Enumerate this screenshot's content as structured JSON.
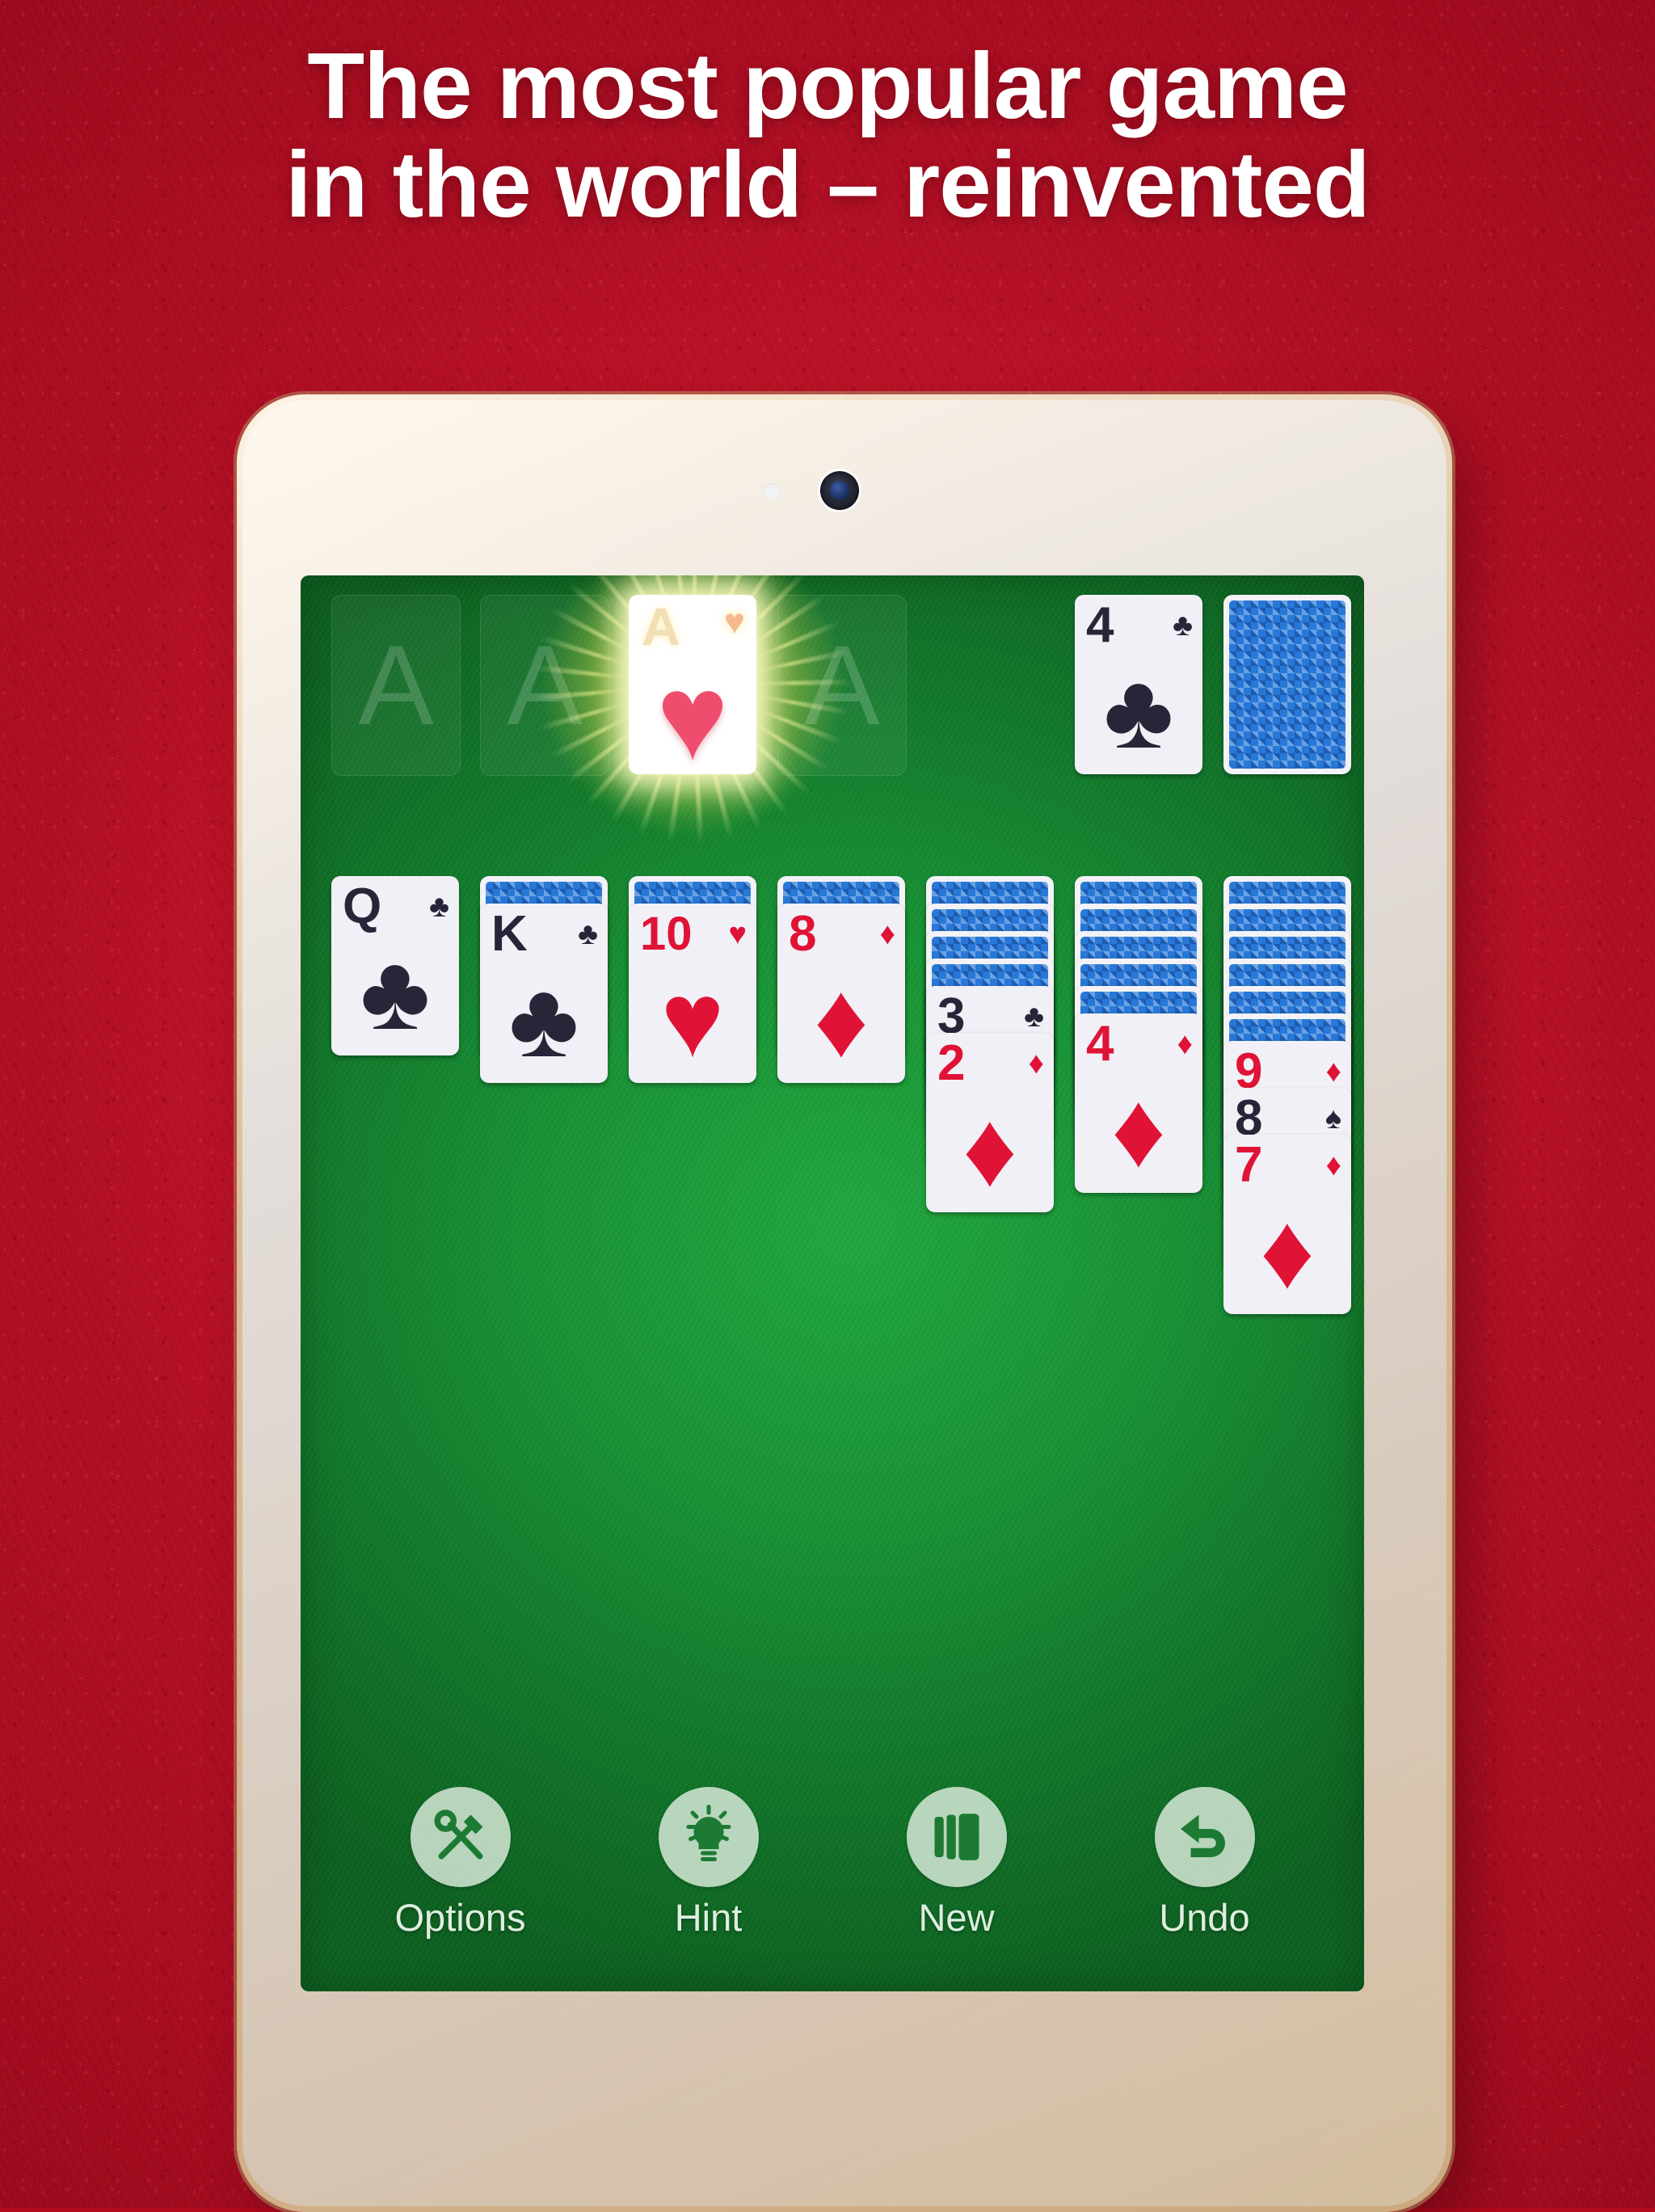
{
  "headline": {
    "line1": "The most popular game",
    "line2": "in the world – reinvented"
  },
  "colors": {
    "backdrop_red": "#a80d22",
    "felt_green": "#169334",
    "card_red": "#e01336",
    "card_black": "#272639",
    "card_back_blue": "#2878d8",
    "glow_yellow": "#fff8a0",
    "toolbar_icon": "#e2f0e2"
  },
  "device": {
    "kind": "tablet",
    "camera": "camera-lens",
    "sensor": "ambient-light-sensor"
  },
  "game": {
    "name": "Solitaire",
    "foundations": [
      {
        "placeholder": "A",
        "card": null
      },
      {
        "placeholder": "A",
        "card": null
      },
      {
        "placeholder": "A",
        "card": {
          "rank": "A",
          "suit": "♥",
          "color": "red",
          "glowing": true
        }
      },
      {
        "placeholder": "A",
        "card": null
      }
    ],
    "waste": {
      "rank": "4",
      "suit": "♣",
      "color": "black"
    },
    "stock": {
      "face_down": true,
      "label": "stock-pile"
    },
    "tableau": [
      {
        "hidden": 0,
        "faceup": [
          {
            "rank": "Q",
            "suit": "♣",
            "color": "black"
          }
        ]
      },
      {
        "hidden": 1,
        "faceup": [
          {
            "rank": "K",
            "suit": "♣",
            "color": "black"
          }
        ]
      },
      {
        "hidden": 1,
        "faceup": [
          {
            "rank": "10",
            "suit": "♥",
            "color": "red"
          }
        ]
      },
      {
        "hidden": 1,
        "faceup": [
          {
            "rank": "8",
            "suit": "♦",
            "color": "red"
          }
        ]
      },
      {
        "hidden": 4,
        "faceup": [
          {
            "rank": "3",
            "suit": "♣",
            "color": "black"
          },
          {
            "rank": "2",
            "suit": "♦",
            "color": "red"
          }
        ]
      },
      {
        "hidden": 5,
        "faceup": [
          {
            "rank": "4",
            "suit": "♦",
            "color": "red"
          }
        ]
      },
      {
        "hidden": 6,
        "faceup": [
          {
            "rank": "9",
            "suit": "♦",
            "color": "red"
          },
          {
            "rank": "8",
            "suit": "♠",
            "color": "black"
          },
          {
            "rank": "7",
            "suit": "♦",
            "color": "red"
          }
        ]
      }
    ]
  },
  "toolbar": {
    "buttons": [
      {
        "label": "Options",
        "icon": "tools-icon"
      },
      {
        "label": "Hint",
        "icon": "lightbulb-icon"
      },
      {
        "label": "New",
        "icon": "card-stack-icon"
      },
      {
        "label": "Undo",
        "icon": "undo-arrow-icon"
      }
    ]
  }
}
